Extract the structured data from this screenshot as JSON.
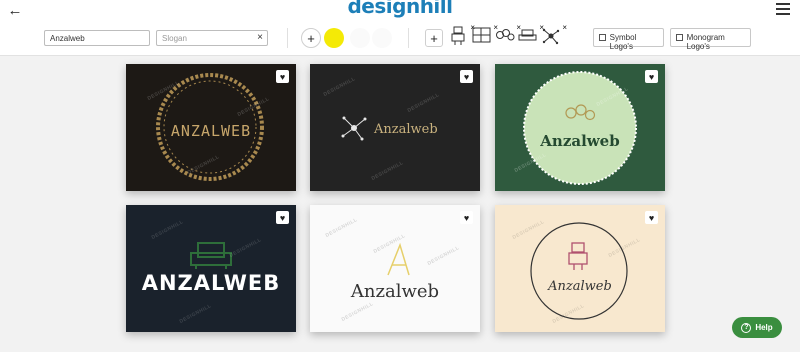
{
  "header": {
    "brand_main": "design",
    "brand_accent": "hill"
  },
  "toolbar": {
    "company_name_value": "Anzalweb",
    "slogan_placeholder": "Slogan",
    "add_label": "+",
    "add_symbol_label": "+",
    "symbol_logos_label": "Symbol Logo's",
    "monogram_logos_label": "Monogram Logo's",
    "selected_color": "#f4ea06",
    "symbols": [
      "robot-icon",
      "frame-icon",
      "molecule-icon",
      "sofa-icon",
      "network-icon"
    ]
  },
  "cards": [
    {
      "text": "ANZALWEB",
      "style": "circular-ornament",
      "background": "#1d1915",
      "watermark": "DESIGNHILL"
    },
    {
      "text": "Anzalweb",
      "style": "network-symbol",
      "background": "#232323",
      "watermark": "DESIGNHILL"
    },
    {
      "text": "Anzalweb",
      "style": "badge-circle",
      "background": "#2f5a3e",
      "watermark": "DESIGNHILL"
    },
    {
      "text": "ANZALWEB",
      "style": "furniture-symbol",
      "background": "#1a222c",
      "watermark": "DESIGNHILL"
    },
    {
      "text": "Anzalweb",
      "style": "letter-a",
      "background": "#fafafa",
      "watermark": "DESIGNHILL"
    },
    {
      "text": "Anzalweb",
      "style": "robot-circle",
      "background": "#f8e8cf",
      "watermark": "DESIGNHILL"
    }
  ],
  "help": {
    "label": "Help",
    "q": "?"
  },
  "favorite_icon": "heart-icon"
}
